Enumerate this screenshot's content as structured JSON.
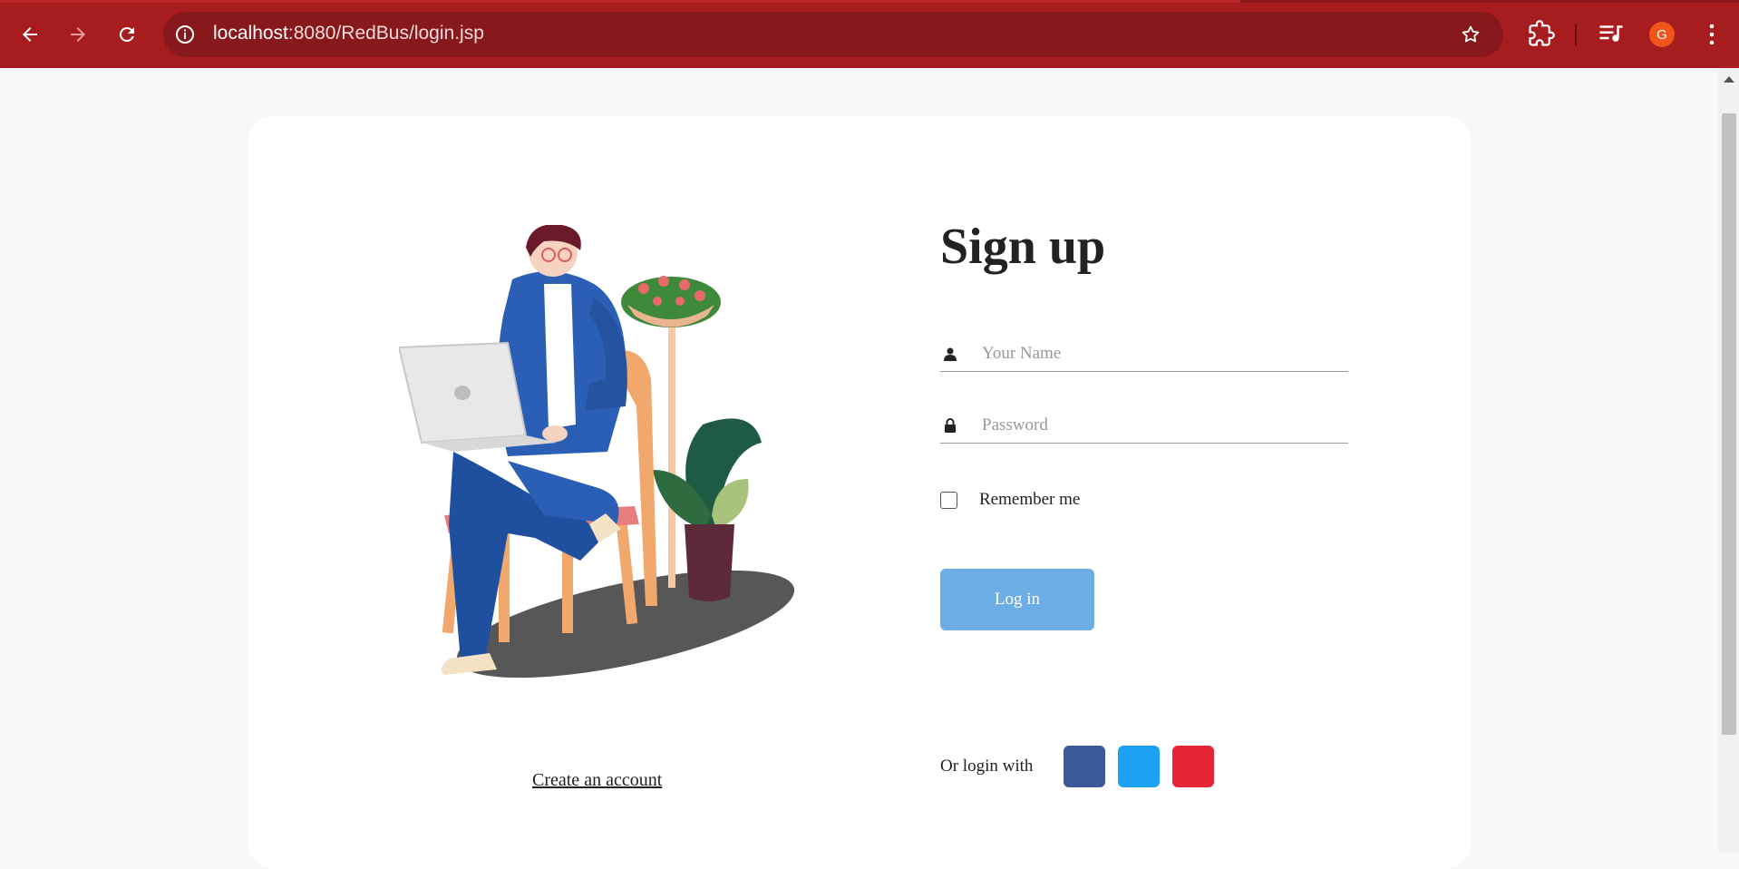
{
  "browser": {
    "url_host": "localhost",
    "url_path": ":8080/RedBus/login.jsp",
    "avatar_letter": "G",
    "colors": {
      "chrome": "#a61c1f",
      "omnibox": "#87191c"
    }
  },
  "form": {
    "title": "Sign up",
    "name_placeholder": "Your Name",
    "password_placeholder": "Password",
    "remember_label": "Remember me",
    "login_button": "Log in",
    "social_label": "Or login with",
    "social_buttons": [
      {
        "name": "facebook",
        "color": "#3b5998"
      },
      {
        "name": "twitter",
        "color": "#1da1f2"
      },
      {
        "name": "google",
        "color": "#e52535"
      }
    ]
  },
  "left": {
    "create_account_link": "Create an account"
  }
}
